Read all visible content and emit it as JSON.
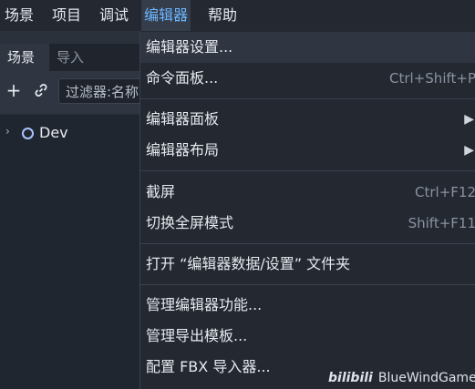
{
  "menubar": {
    "items": [
      {
        "label": "场景"
      },
      {
        "label": "项目"
      },
      {
        "label": "调试"
      },
      {
        "label": "编辑器"
      },
      {
        "label": "帮助"
      }
    ]
  },
  "dock": {
    "tabs": [
      "场景",
      "导入"
    ],
    "filter_text": "过滤器:名称",
    "tree": [
      {
        "label": "Dev"
      }
    ]
  },
  "editor_menu": {
    "items": [
      {
        "label": "编辑器设置...",
        "shortcut": ""
      },
      {
        "label": "命令面板...",
        "shortcut": "Ctrl+Shift+P"
      },
      {
        "label": "编辑器面板",
        "shortcut": ""
      },
      {
        "label": "编辑器布局",
        "shortcut": ""
      },
      {
        "label": "截屏",
        "shortcut": "Ctrl+F12"
      },
      {
        "label": "切换全屏模式",
        "shortcut": "Shift+F11"
      },
      {
        "label": "打开 “编辑器数据/设置” 文件夹",
        "shortcut": ""
      },
      {
        "label": "管理编辑器功能...",
        "shortcut": ""
      },
      {
        "label": "管理导出模板...",
        "shortcut": ""
      },
      {
        "label": "配置 FBX 导入器...",
        "shortcut": ""
      }
    ]
  },
  "watermark": {
    "logo": "bilibili",
    "text": "BlueWindGame"
  },
  "colors": {
    "accent": "#6cb6ff",
    "menu_bg": "#232831",
    "panel_bg": "#2b313b"
  }
}
